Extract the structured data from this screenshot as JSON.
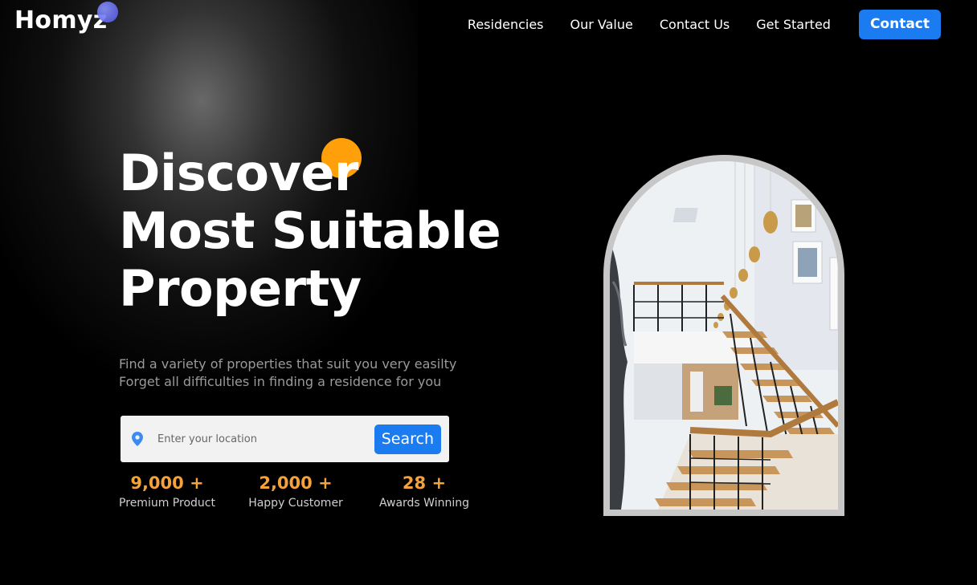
{
  "brand": {
    "name": "Homyz"
  },
  "nav": {
    "items": [
      "Residencies",
      "Our Value",
      "Contact Us",
      "Get Started"
    ],
    "cta": "Contact"
  },
  "hero": {
    "title_lines": [
      "Discover",
      "Most Suitable",
      "Property"
    ],
    "subtitle_lines": [
      "Find a variety of properties that suit you very easilty",
      "Forget all difficulties in finding a residence for you"
    ]
  },
  "search": {
    "placeholder": "Enter your location",
    "button": "Search",
    "icon": "location-pin-icon"
  },
  "stats": [
    {
      "value": "9,000 +",
      "label": "Premium Product"
    },
    {
      "value": "2,000 +",
      "label": "Happy Customer"
    },
    {
      "value": "28 +",
      "label": "Awards Winning"
    }
  ],
  "colors": {
    "accent_blue": "#1a7cf0",
    "accent_orange": "#ffa00a",
    "stat_orange": "#f6a23a",
    "background": "#000000"
  }
}
